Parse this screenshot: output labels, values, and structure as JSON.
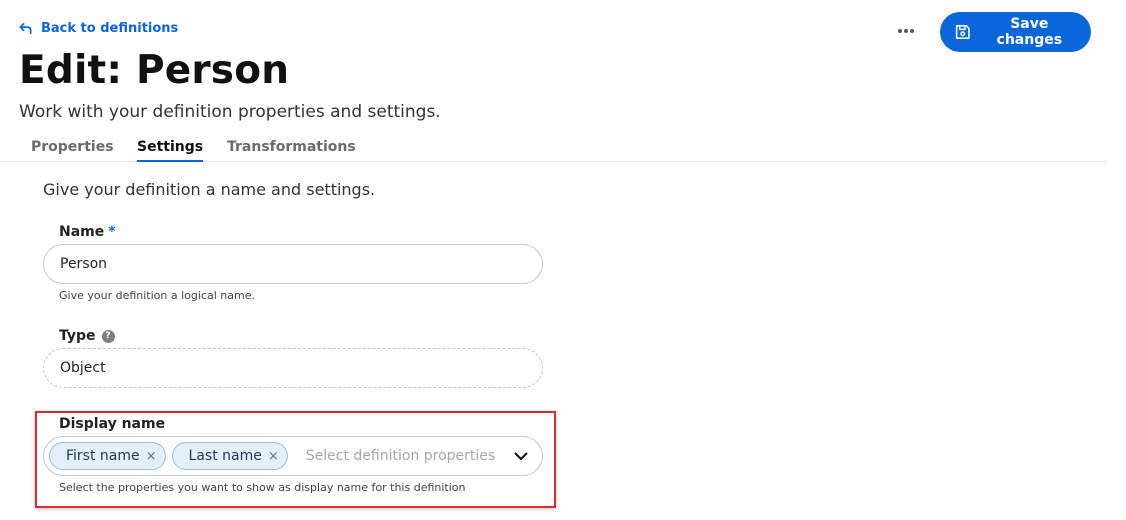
{
  "header": {
    "back_label": "Back to definitions",
    "title": "Edit: Person",
    "subtitle": "Work with your definition properties and settings.",
    "save_label": "Save changes"
  },
  "tabs": [
    {
      "label": "Properties",
      "active": false
    },
    {
      "label": "Settings",
      "active": true
    },
    {
      "label": "Transformations",
      "active": false
    }
  ],
  "settings": {
    "intro": "Give your definition a name and settings.",
    "name": {
      "label": "Name",
      "required_marker": "*",
      "value": "Person",
      "hint": "Give your definition a logical name."
    },
    "type": {
      "label": "Type",
      "help_glyph": "?",
      "value": "Object"
    },
    "display_name": {
      "label": "Display name",
      "selected": [
        {
          "label": "First name"
        },
        {
          "label": "Last name"
        }
      ],
      "remove_glyph": "×",
      "placeholder": "Select definition properties",
      "hint": "Select the properties you want to show as display name for this definition"
    }
  },
  "colors": {
    "accent": "#0a66d9",
    "chip_background": "#e3f0fc",
    "chip_border": "#8fc1ef",
    "highlight_border": "#d32f2f"
  },
  "icons": {
    "back": "arrow-back-icon",
    "more": "more-horizontal-icon",
    "save": "floppy-disk-icon",
    "help": "help-circle-icon",
    "remove": "close-icon",
    "dropdown": "chevron-down-icon"
  }
}
